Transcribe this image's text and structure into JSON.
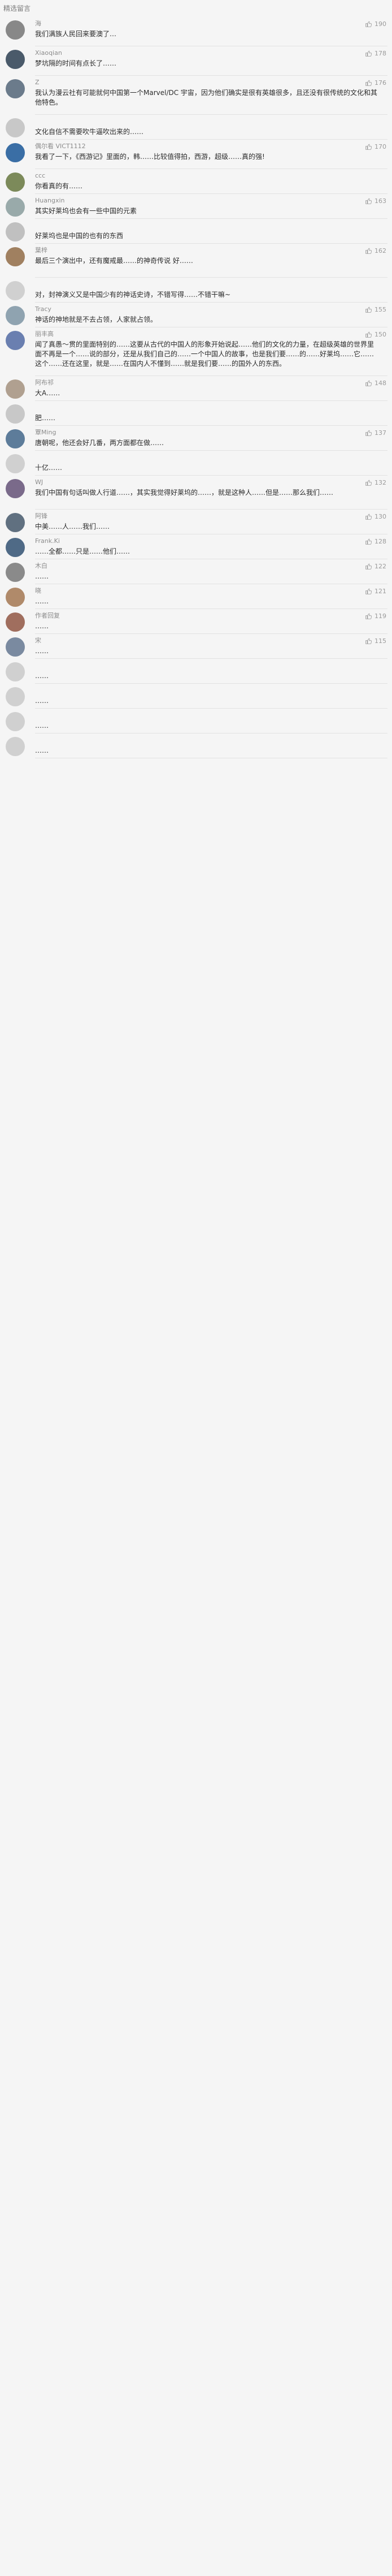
{
  "header": {
    "title": "精选留言"
  },
  "comments": [
    {
      "user": "海",
      "likes": "190",
      "text": "我们满族人民回来要澳了…",
      "h": 52,
      "color": "#888888"
    },
    {
      "user": "Xiaoqian",
      "likes": "178",
      "text": "梦坑隔的时间有点长了……",
      "h": 52,
      "color": "#4a5a6a"
    },
    {
      "user": "Z",
      "likes": "176",
      "text": "我认为漫云社有可能就何中国第一个Marvel/DC 宇宙，因为他们确实是很有英雄很多，且还没有很传统的文化和其他特色。",
      "h": 69,
      "color": "#6b7b8b"
    },
    {
      "user": "",
      "likes": "",
      "text": "文化自信不需要吹牛逼吹出来的……",
      "h": 44,
      "color": "#c8c8c8"
    },
    {
      "user": "偶尔看 VICT1112",
      "likes": "170",
      "text": "我看了一下，《西游记》里面的，韩……比较值得拍，西游，超级……真的强!",
      "h": 52,
      "color": "#3a6ea5"
    },
    {
      "user": "ccc",
      "likes": "",
      "text": "你看真的有……",
      "h": 44,
      "color": "#7c8a5a"
    },
    {
      "user": "Huangxin",
      "likes": "163",
      "text": "其实好莱坞也会有一些中国的元素",
      "h": 44,
      "color": "#9aa"
    },
    {
      "user": "",
      "likes": "",
      "text": "好莱坞也是中国的也有的东西",
      "h": 44,
      "color": "#c0c0c0"
    },
    {
      "user": "葉梓",
      "likes": "162",
      "text": "最后三个演出中，还有魔戒最……的神奇传说\n好……",
      "h": 60,
      "color": "#a08060"
    },
    {
      "user": "",
      "likes": "",
      "text": "对，封神演义又是中国少有的神话史诗，不错写得……不错干嘛~",
      "h": 44,
      "color": "#d0d0d0"
    },
    {
      "user": "Tracy",
      "likes": "155",
      "text": "神话的神地就是不去占领，人家就占领。",
      "h": 44,
      "color": "#8fa3b0"
    },
    {
      "user": "丽丰高",
      "likes": "150",
      "text": "闻了真愚～贯的里面特别的……这要从古代的中国人的形象开始说起……他们的文化的力量，在超级英雄的世界里面不再是一个……说的部分，还是从我们自己的……一个中国人的故事，也是我们要……的……好莱坞……它……这个……还在这里，就是……在国内人不懂到……就是我们要……的国外人的东西。",
      "h": 86,
      "color": "#6a7fb0"
    },
    {
      "user": "阿布祁",
      "likes": "148",
      "text": "大A……",
      "h": 44,
      "color": "#b0a090"
    },
    {
      "user": "",
      "likes": "",
      "text": "肥……",
      "h": 44,
      "color": "#c8c8c8"
    },
    {
      "user": "覃Ming",
      "likes": "137",
      "text": "唐朝呢，他还会好几番，两方面都在做……",
      "h": 44,
      "color": "#5d7c9a"
    },
    {
      "user": "",
      "likes": "",
      "text": "十亿……",
      "h": 44,
      "color": "#d0d0d0"
    },
    {
      "user": "WJ",
      "likes": "132",
      "text": "我们中国有句话叫做人行道……，其实我觉得好莱坞的……，就是这种人……但是……那么我们……",
      "h": 60,
      "color": "#7a6a8a"
    },
    {
      "user": "阿锋",
      "likes": "130",
      "text": "中美……人……我们……",
      "h": 44,
      "color": "#607080"
    },
    {
      "user": "Frank.Ki",
      "likes": "128",
      "text": "……全都……只是……他们……",
      "h": 44,
      "color": "#4f6a86"
    },
    {
      "user": "木白",
      "likes": "122",
      "text": "……",
      "h": 44,
      "color": "#8a8a8a"
    },
    {
      "user": "晓",
      "likes": "121",
      "text": "……",
      "h": 44,
      "color": "#b08a6a"
    },
    {
      "user": "作者回复",
      "likes": "119",
      "text": "……",
      "h": 44,
      "color": "#a06e5e"
    },
    {
      "user": "宋",
      "likes": "115",
      "text": "……",
      "h": 44,
      "color": "#7a8aa0"
    },
    {
      "user": "",
      "likes": "",
      "text": "……",
      "h": 44,
      "color": "#d0d0d0"
    },
    {
      "user": "",
      "likes": "",
      "text": "……",
      "h": 44,
      "color": "#d0d0d0"
    },
    {
      "user": "",
      "likes": "",
      "text": "……",
      "h": 44,
      "color": "#d0d0d0"
    },
    {
      "user": "",
      "likes": "",
      "text": "……",
      "h": 44,
      "color": "#d0d0d0"
    }
  ]
}
